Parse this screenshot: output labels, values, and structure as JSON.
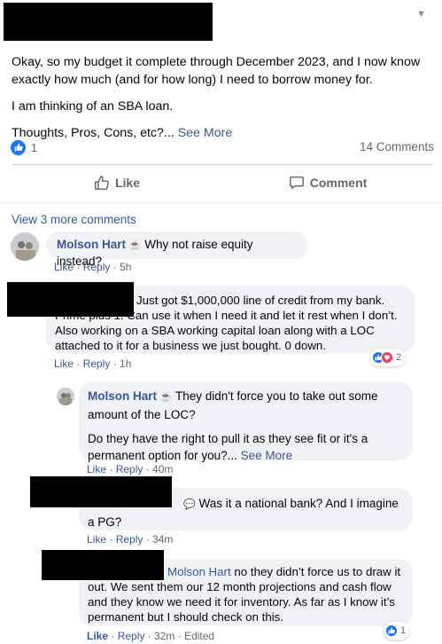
{
  "post": {
    "paragraphs": [
      "Okay, so my budget it complete through December 2023, and I now know exactly how much (and for how long) I need to borrow money for.",
      "I am thinking of an SBA loan."
    ],
    "last_line": "Thoughts, Pros, Cons, etc?...",
    "see_more": "See More",
    "reaction_count": "1",
    "comments_count": "14 Comments"
  },
  "actions": {
    "like": "Like",
    "comment": "Comment"
  },
  "view_more_comments": "View 3 more comments",
  "comments": [
    {
      "author": "Molson Hart",
      "text": "Why not raise equity instead?",
      "like": "Like",
      "reply": "Reply",
      "time": "5h"
    },
    {
      "author": "",
      "text": "Just got $1,000,000 line of credit from my bank. Prime plus 1. Can use it when I need it and let it rest when I don’t. Also working on a SBA working capital loan along with a LOC attached to it for a business we just bought. 0 down.",
      "like": "Like",
      "reply": "Reply",
      "time": "1h",
      "reaction_count": "2"
    },
    {
      "author": "Molson Hart",
      "text": "They didn't force you to take out some amount of the LOC?",
      "text2": "Do they have the right to pull it as they see fit or it's a permanent option for you?...",
      "see_more": "See More",
      "like": "Like",
      "reply": "Reply",
      "time": "40m"
    },
    {
      "author": "",
      "text": "Was it a national bank? And I imagine a PG?",
      "like": "Like",
      "reply": "Reply",
      "time": "34m"
    },
    {
      "author": "",
      "mention": "Molson Hart",
      "text": "no they didn’t force us to draw it out. We sent them our 12 month projections and cash flow and they know we need it for inventory. As far as I know it’s permanent but I should check on this.",
      "like": "Like",
      "reply": "Reply",
      "time": "32m",
      "edited": "Edited",
      "reaction_count": "1"
    }
  ],
  "colors": {
    "link": "#385898",
    "like_blue": "#1877f2",
    "love_red": "#f33e58",
    "bubble": "#f0f2f5",
    "muted": "#65676b"
  },
  "icons": [
    "chevron-down-icon",
    "thumbs-up-icon",
    "comment-icon",
    "coffee-icon",
    "speech-bubble-icon",
    "heart-icon"
  ]
}
